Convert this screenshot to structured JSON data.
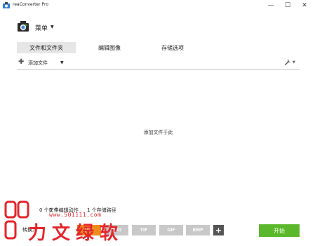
{
  "window": {
    "title": "reaConverter Pro",
    "min_glyph": "—",
    "max_glyph": "☐",
    "close_glyph": "✕"
  },
  "menu": {
    "label": "菜单",
    "caret": "▼"
  },
  "tabs": [
    {
      "label": "文件和文件夹",
      "active": true
    },
    {
      "label": "编辑图像",
      "active": false
    },
    {
      "label": "存储选项",
      "active": false
    }
  ],
  "toolbar": {
    "plus": "✚",
    "add_files": "添加文件",
    "caret": "▼",
    "wrench": "🔧",
    "wrench_caret": "▼"
  },
  "drop_area": {
    "hint": "添加文件于此"
  },
  "status": {
    "files": "0 个文件",
    "actions": "0 个编辑动作",
    "paths": "1 个存储路径"
  },
  "bottom": {
    "save_as": "转换为",
    "formats": [
      {
        "label": "JPG",
        "active": true
      },
      {
        "label": "PNG",
        "active": false
      },
      {
        "label": "TIF",
        "active": false
      },
      {
        "label": "GIF",
        "active": false
      },
      {
        "label": "BMP",
        "active": false
      }
    ],
    "plus": "+",
    "start": "开始"
  },
  "watermark": {
    "text": "力文绿软",
    "url": "www.501111.com"
  },
  "colors": {
    "accent_start": "#5ab82a",
    "format_active": "#f08a1c",
    "format_inactive": "#c8c8c8",
    "watermark": "#e3262b"
  }
}
